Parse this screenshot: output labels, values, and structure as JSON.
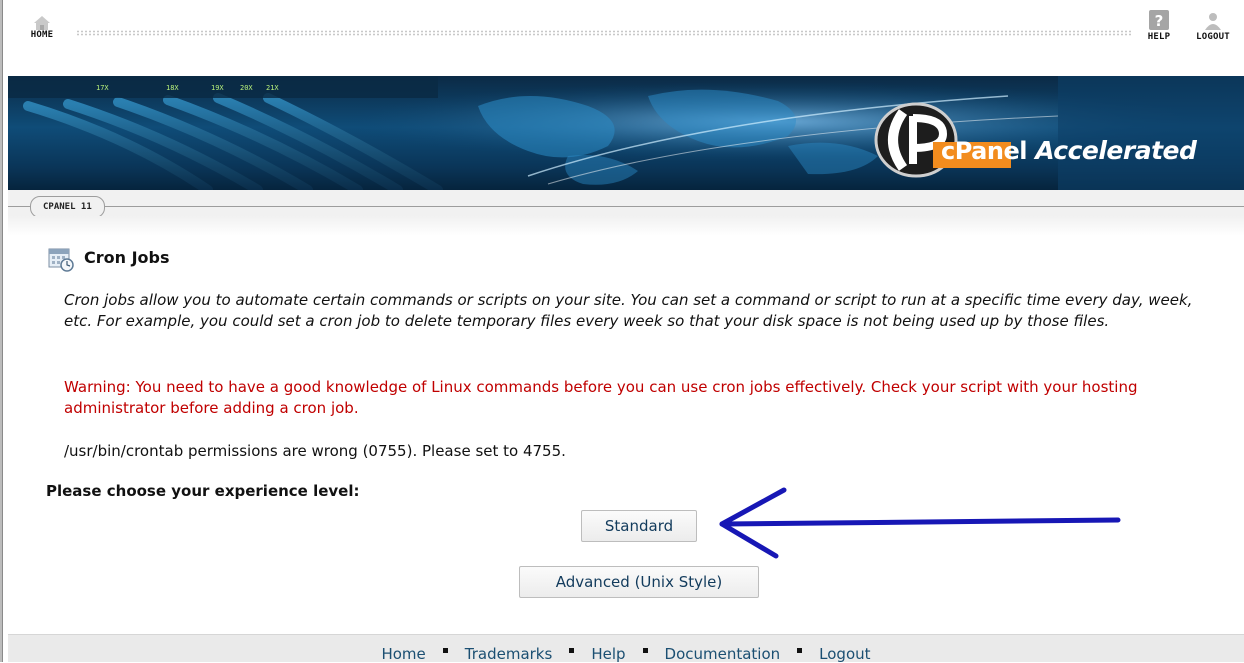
{
  "topnav": {
    "home": {
      "label": "HOME",
      "icon": "house-icon"
    },
    "help": {
      "label": "HELP",
      "icon": "question-icon"
    },
    "logout": {
      "label": "LOGOUT",
      "icon": "user-icon"
    }
  },
  "banner": {
    "brand_name": "cPanel",
    "brand_suffix": "Accelerated",
    "rack_labels": [
      "17X",
      "18X",
      "19X",
      "20X",
      "21X"
    ]
  },
  "tab": {
    "label": "CPANEL 11"
  },
  "page": {
    "title": "Cron Jobs",
    "title_icon": "calendar-clock-icon",
    "intro": "Cron jobs allow you to automate certain commands or scripts on your site. You can set a command or script to run at a specific time every day, week, etc. For example, you could set a cron job to delete temporary files every week so that your disk space is not being used up by those files.",
    "warning": "Warning: You need to have a good knowledge of Linux commands before you can use cron jobs effectively. Check your script with your hosting administrator before adding a cron job.",
    "notice": "/usr/bin/crontab permissions are wrong (0755). Please set to 4755.",
    "choose_label": "Please choose your experience level:",
    "buttons": {
      "standard": "Standard",
      "advanced": "Advanced (Unix Style)"
    }
  },
  "footer": {
    "links": [
      "Home",
      "Trademarks",
      "Help",
      "Documentation",
      "Logout"
    ]
  },
  "colors": {
    "warning": "#c00000",
    "link": "#1b4f72",
    "button_text": "#123b5c",
    "annotation_arrow": "#1717b5",
    "banner_bg": "#0f4c78"
  }
}
